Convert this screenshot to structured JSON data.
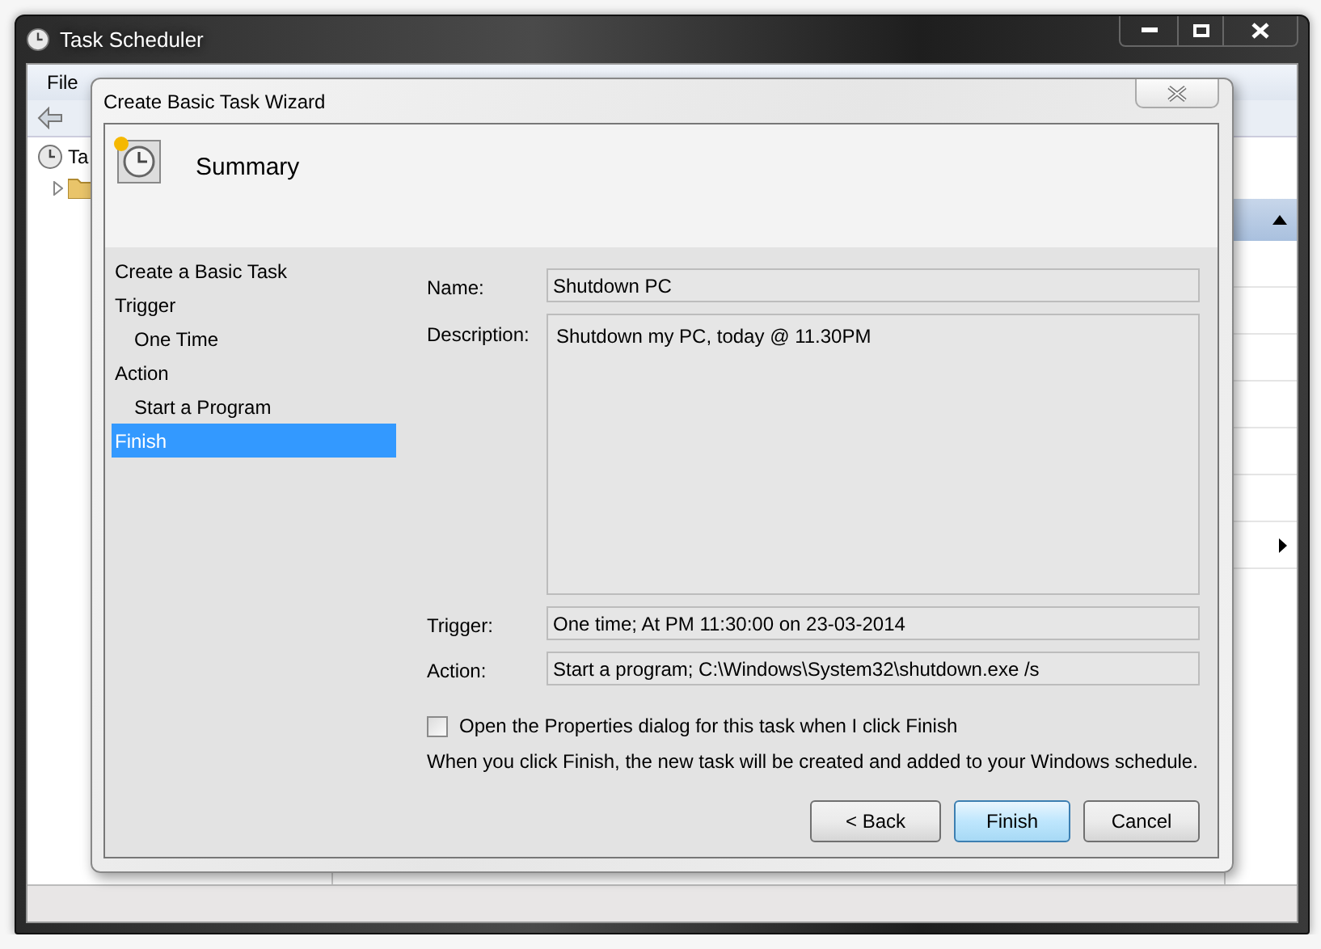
{
  "main_window": {
    "title": "Task Scheduler",
    "menu": [
      "File"
    ],
    "tree_root": "Ta"
  },
  "wizard": {
    "title": "Create Basic Task Wizard",
    "heading": "Summary",
    "steps": [
      {
        "label": "Create a Basic Task",
        "selected": false
      },
      {
        "label": "Trigger",
        "selected": false,
        "children": [
          {
            "label": "One Time",
            "selected": false
          }
        ]
      },
      {
        "label": "Action",
        "selected": false,
        "children": [
          {
            "label": "Start a Program",
            "selected": false
          }
        ]
      },
      {
        "label": "Finish",
        "selected": true
      }
    ],
    "fields": [
      {
        "kind": "line",
        "label": "Name:",
        "value": "Shutdown PC"
      },
      {
        "kind": "multiline",
        "label": "Description:",
        "value": "Shutdown my PC, today @ 11.30PM"
      },
      {
        "kind": "line",
        "label": "Trigger:",
        "value": "One time; At PM 11:30:00 on 23-03-2014"
      },
      {
        "kind": "line",
        "label": "Action:",
        "value": "Start a program; C:\\Windows\\System32\\shutdown.exe /s"
      }
    ],
    "open_properties": {
      "label": "Open the Properties dialog for this task when I click Finish",
      "checked": false
    },
    "note": "When you click Finish, the new task will be created and added to your Windows schedule.",
    "buttons": [
      {
        "label": "< Back",
        "default": false
      },
      {
        "label": "Finish",
        "default": true
      },
      {
        "label": "Cancel",
        "default": false
      }
    ]
  }
}
